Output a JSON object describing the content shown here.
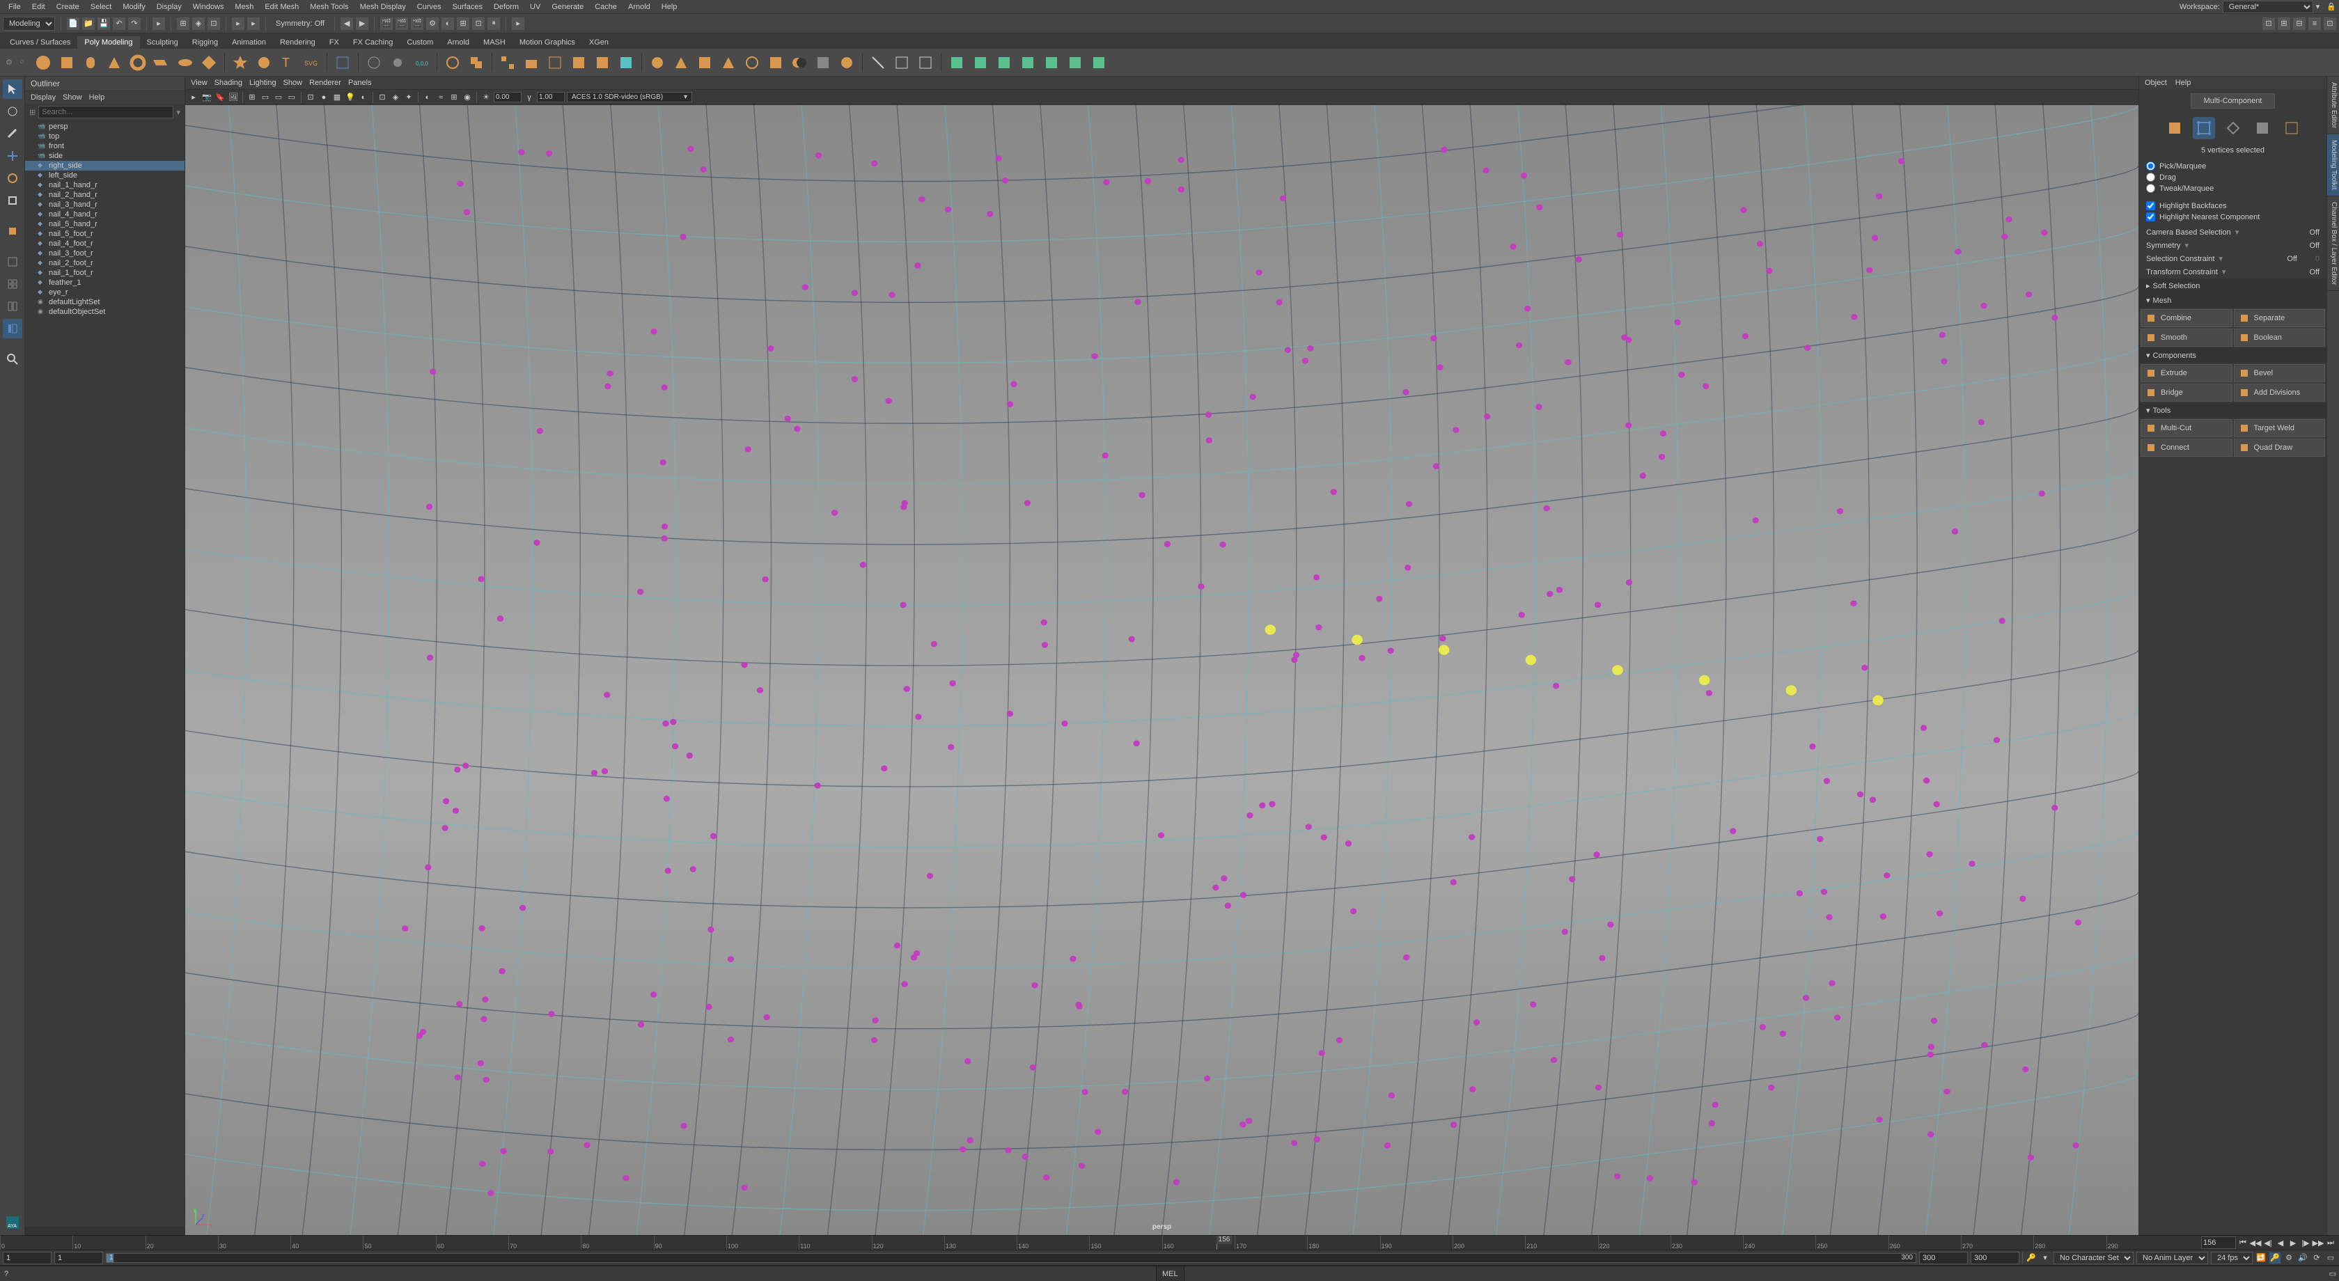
{
  "menubar": {
    "items": [
      "File",
      "Edit",
      "Create",
      "Select",
      "Modify",
      "Display",
      "Windows",
      "Mesh",
      "Edit Mesh",
      "Mesh Tools",
      "Mesh Display",
      "Curves",
      "Surfaces",
      "Deform",
      "UV",
      "Generate",
      "Cache",
      "Arnold",
      "Help"
    ],
    "workspace_label": "Workspace:",
    "workspace_value": "General*"
  },
  "toolbar1": {
    "mode": "Modeling",
    "symmetry": "Symmetry: Off"
  },
  "shelf_tabs": [
    "Curves / Surfaces",
    "Poly Modeling",
    "Sculpting",
    "Rigging",
    "Animation",
    "Rendering",
    "FX",
    "FX Caching",
    "Custom",
    "Arnold",
    "MASH",
    "Motion Graphics",
    "XGen"
  ],
  "shelf_active": 1,
  "outliner": {
    "title": "Outliner",
    "menus": [
      "Display",
      "Show",
      "Help"
    ],
    "search_placeholder": "Search...",
    "items": [
      {
        "name": "persp",
        "type": "cam"
      },
      {
        "name": "top",
        "type": "cam"
      },
      {
        "name": "front",
        "type": "cam"
      },
      {
        "name": "side",
        "type": "cam"
      },
      {
        "name": "right_side",
        "type": "mesh",
        "selected": true
      },
      {
        "name": "left_side",
        "type": "mesh"
      },
      {
        "name": "nail_1_hand_r",
        "type": "mesh"
      },
      {
        "name": "nail_2_hand_r",
        "type": "mesh"
      },
      {
        "name": "nail_3_hand_r",
        "type": "mesh"
      },
      {
        "name": "nail_4_hand_r",
        "type": "mesh"
      },
      {
        "name": "nail_5_hand_r",
        "type": "mesh"
      },
      {
        "name": "nail_5_foot_r",
        "type": "mesh"
      },
      {
        "name": "nail_4_foot_r",
        "type": "mesh"
      },
      {
        "name": "nail_3_foot_r",
        "type": "mesh"
      },
      {
        "name": "nail_2_foot_r",
        "type": "mesh"
      },
      {
        "name": "nail_1_foot_r",
        "type": "mesh"
      },
      {
        "name": "feather_1",
        "type": "mesh"
      },
      {
        "name": "eye_r",
        "type": "mesh"
      },
      {
        "name": "defaultLightSet",
        "type": "set"
      },
      {
        "name": "defaultObjectSet",
        "type": "set"
      }
    ]
  },
  "viewport": {
    "menus": [
      "View",
      "Shading",
      "Lighting",
      "Show",
      "Renderer",
      "Panels"
    ],
    "exposure": "0.00",
    "gamma": "1.00",
    "colorspace": "ACES 1.0 SDR-video (sRGB)",
    "camera_label": "persp"
  },
  "right_panel": {
    "menus": [
      "Object",
      "Help"
    ],
    "multi_component": "Multi-Component",
    "selection_info": "5 vertices selected",
    "pick_modes": [
      "Pick/Marquee",
      "Drag",
      "Tweak/Marquee"
    ],
    "pick_active": 0,
    "highlight_backfaces": "Highlight Backfaces",
    "highlight_nearest": "Highlight Nearest Component",
    "camera_sel": {
      "label": "Camera Based Selection",
      "value": "Off"
    },
    "symmetry": {
      "label": "Symmetry",
      "value": "Off"
    },
    "sel_constraint": {
      "label": "Selection Constraint",
      "value": "Off",
      "num": "0"
    },
    "trans_constraint": {
      "label": "Transform Constraint",
      "value": "Off"
    },
    "soft_selection": "Soft Selection",
    "mesh_hdr": "Mesh",
    "mesh_btns": [
      "Combine",
      "Separate",
      "Smooth",
      "Boolean"
    ],
    "components_hdr": "Components",
    "comp_btns": [
      "Extrude",
      "Bevel",
      "Bridge",
      "Add Divisions"
    ],
    "tools_hdr": "Tools",
    "tool_btns": [
      "Multi-Cut",
      "Target Weld",
      "Connect",
      "Quad Draw"
    ]
  },
  "right_tabs": [
    "Attribute Editor",
    "Modeling Toolkit",
    "Channel Box / Layer Editor"
  ],
  "right_tab_active": 1,
  "timeline": {
    "ticks": [
      "0",
      "10",
      "20",
      "30",
      "40",
      "50",
      "60",
      "70",
      "80",
      "90",
      "100",
      "110",
      "120",
      "130",
      "140",
      "150",
      "160",
      "170",
      "180",
      "190",
      "200",
      "210",
      "220",
      "230",
      "240",
      "250",
      "260",
      "270",
      "280",
      "290"
    ],
    "current_label": "156",
    "current": "156",
    "start": "1",
    "range_start": "1",
    "range_slider_start": "1",
    "range_end": "300",
    "end": "300",
    "end2": "300",
    "char_set": "No Character Set",
    "anim_layer": "No Anim Layer",
    "fps": "24 fps"
  },
  "statusbar": {
    "cmd_label": "MEL"
  }
}
